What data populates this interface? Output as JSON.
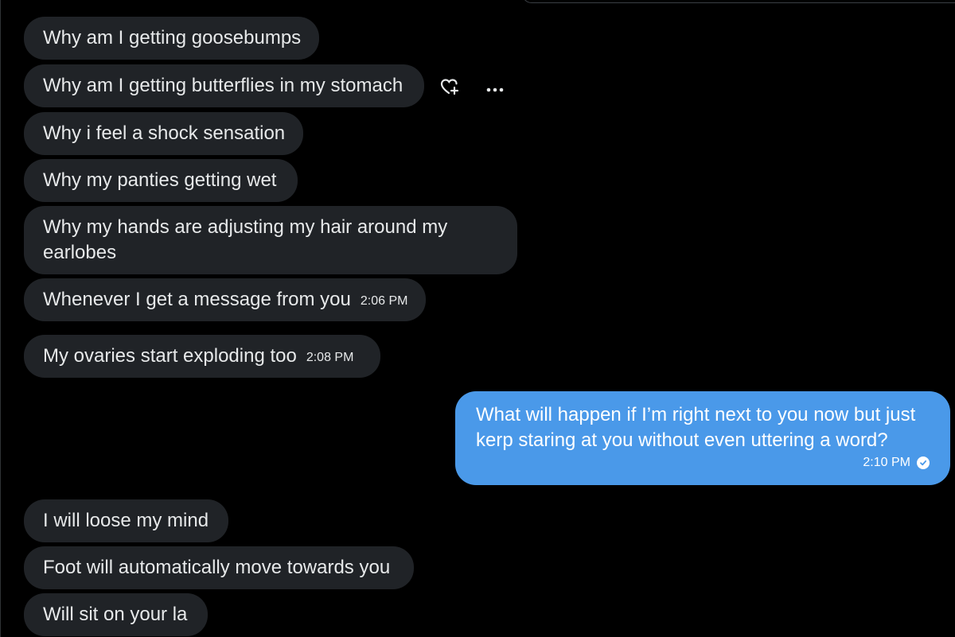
{
  "received_block_1": [
    {
      "text": "Why am I getting goosebumps"
    },
    {
      "text": "Why am I getting butterflies in my stomach"
    },
    {
      "text": "Why i feel a shock sensation"
    },
    {
      "text": "Why my panties getting wet"
    },
    {
      "text": "Why my hands are adjusting my hair around my earlobes"
    },
    {
      "text": "Whenever I get a message from you",
      "time": "2:06 PM"
    }
  ],
  "received_block_2": [
    {
      "text": "My ovaries start exploding too",
      "time": "2:08 PM"
    }
  ],
  "sent_message": {
    "text": "What will happen if I’m right next to you now but just kerp staring at you without even uttering a word?",
    "time": "2:10 PM",
    "status_icon": "read-check-icon"
  },
  "received_block_3": [
    {
      "text": "I will loose my mind"
    },
    {
      "text": "Foot will automatically move towards you"
    },
    {
      "text": "Will sit on your la"
    }
  ],
  "hover_actions": {
    "react_icon": "heart-plus-icon",
    "more_icon": "more-dots-icon"
  },
  "colors": {
    "background": "#000000",
    "received_bubble": "#202327",
    "sent_bubble": "#4a99e9",
    "text": "#e7e9ea"
  }
}
